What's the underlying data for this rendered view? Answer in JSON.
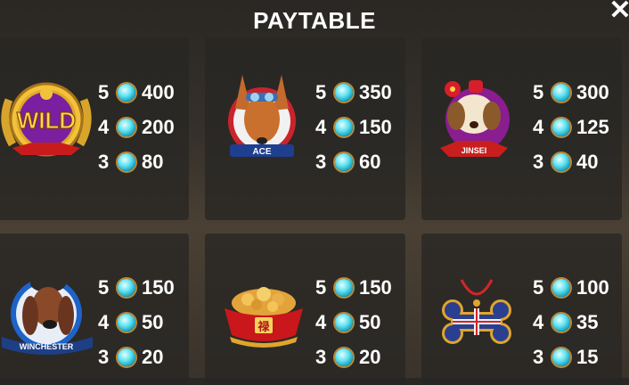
{
  "title": "PAYTABLE",
  "colors": {
    "gem": "#4fd7ea",
    "panel": "#2a2826",
    "text": "#ffffff"
  },
  "symbols": [
    {
      "name": "WILD",
      "icon": "wild-medallion-icon",
      "pays": [
        {
          "count": "5",
          "value": "400"
        },
        {
          "count": "4",
          "value": "200"
        },
        {
          "count": "3",
          "value": "80"
        }
      ]
    },
    {
      "name": "ACE",
      "icon": "ace-dog-icon",
      "pays": [
        {
          "count": "5",
          "value": "350"
        },
        {
          "count": "4",
          "value": "150"
        },
        {
          "count": "3",
          "value": "60"
        }
      ]
    },
    {
      "name": "JINSEI",
      "icon": "jinsei-dog-icon",
      "pays": [
        {
          "count": "5",
          "value": "300"
        },
        {
          "count": "4",
          "value": "125"
        },
        {
          "count": "3",
          "value": "40"
        }
      ]
    },
    {
      "name": "WINCHESTER",
      "icon": "winchester-dog-icon",
      "pays": [
        {
          "count": "5",
          "value": "150"
        },
        {
          "count": "4",
          "value": "50"
        },
        {
          "count": "3",
          "value": "20"
        }
      ]
    },
    {
      "name": "",
      "icon": "food-bowl-icon",
      "pays": [
        {
          "count": "5",
          "value": "150"
        },
        {
          "count": "4",
          "value": "50"
        },
        {
          "count": "3",
          "value": "20"
        }
      ]
    },
    {
      "name": "",
      "icon": "bone-icon",
      "pays": [
        {
          "count": "5",
          "value": "100"
        },
        {
          "count": "4",
          "value": "35"
        },
        {
          "count": "3",
          "value": "15"
        }
      ]
    }
  ],
  "bowl_char": "禄"
}
